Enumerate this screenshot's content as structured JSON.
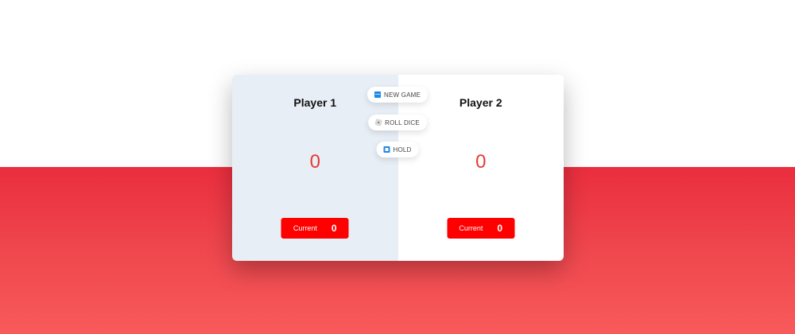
{
  "players": [
    {
      "name": "Player 1",
      "score": "0",
      "current_label": "Current",
      "current_score": "0",
      "active": true
    },
    {
      "name": "Player 2",
      "score": "0",
      "current_label": "Current",
      "current_score": "0",
      "active": false
    }
  ],
  "controls": {
    "new_game_label": "NEW GAME",
    "roll_dice_label": "ROLL DICE",
    "hold_label": "HOLD"
  },
  "icons": {
    "new_game": "new-game-icon",
    "roll_dice": "dice-icon",
    "hold": "hold-icon"
  },
  "colors": {
    "background_top": "#ffffff",
    "background_bottom": "#ea2e3e",
    "active_panel": "#e8eef5",
    "inactive_panel": "#ffffff",
    "score": "#e53935",
    "current_box": "#ff0000"
  }
}
